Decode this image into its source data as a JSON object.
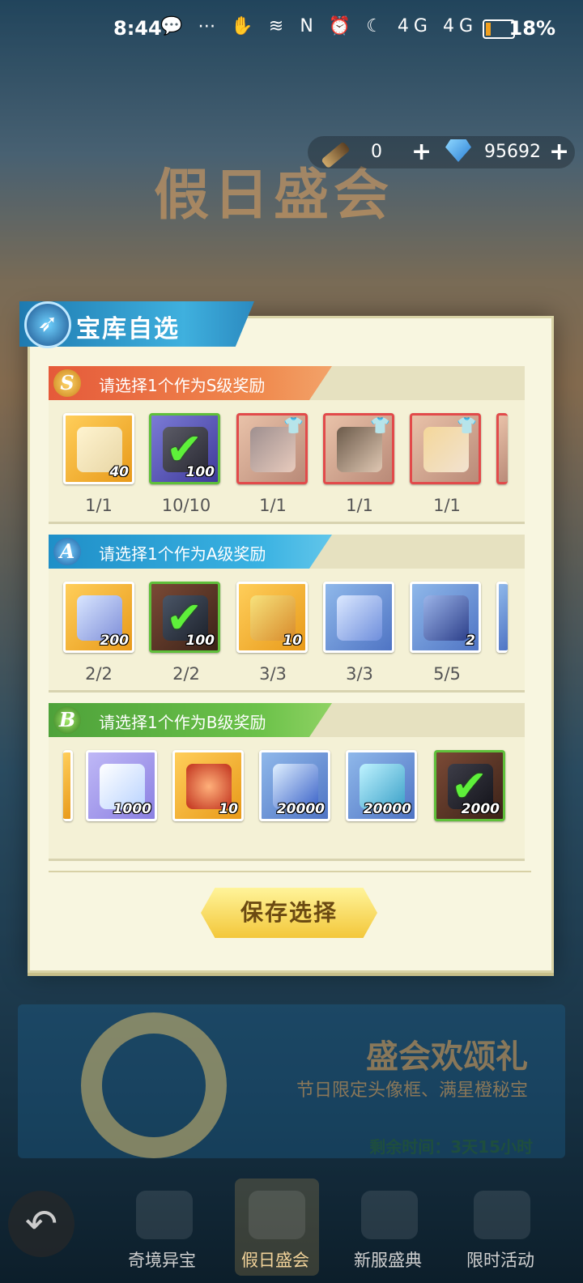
{
  "status_bar": {
    "time": "8:44",
    "left_icons": "💬 ⋯ ✋ ≋",
    "right_icons": "N ⏰ ☾ 4G 4G",
    "battery_percent": "18%"
  },
  "currency": {
    "item_count": "0",
    "gems": "95692"
  },
  "banner_title": "假日盛会",
  "modal": {
    "title": "宝库自选",
    "save_button": "保存选择",
    "sections": [
      {
        "grade": "S",
        "title": "请选择1个作为S级奖励",
        "items": [
          {
            "icon": "golden-scroll-icon",
            "qty": "40",
            "count": "1/1",
            "selected": false
          },
          {
            "icon": "mystery-cube-icon",
            "qty": "100",
            "count": "10/10",
            "selected": true
          },
          {
            "icon": "hero-portrait-icon",
            "qty": "",
            "count": "1/1",
            "selected": false
          },
          {
            "icon": "hero-portrait-icon",
            "qty": "",
            "count": "1/1",
            "selected": false
          },
          {
            "icon": "hero-portrait-icon",
            "qty": "",
            "count": "1/1",
            "selected": false
          }
        ]
      },
      {
        "grade": "A",
        "title": "请选择1个作为A级奖励",
        "items": [
          {
            "icon": "crystal-shard-icon",
            "qty": "200",
            "count": "2/2",
            "selected": false
          },
          {
            "icon": "dark-star-icon",
            "qty": "100",
            "count": "2/2",
            "selected": true
          },
          {
            "icon": "treasure-chest-icon",
            "qty": "10",
            "count": "3/3",
            "selected": false
          },
          {
            "icon": "magic-fruit-icon",
            "qty": "",
            "count": "3/3",
            "selected": false
          },
          {
            "icon": "rune-stone-icon",
            "qty": "2",
            "count": "5/5",
            "selected": false
          }
        ]
      },
      {
        "grade": "B",
        "title": "请选择1个作为B级奖励",
        "items": [
          {
            "icon": "crystal-ore-icon",
            "qty": "1000",
            "selected": false
          },
          {
            "icon": "red-gem-icon",
            "qty": "10",
            "selected": false
          },
          {
            "icon": "blue-crystal-icon",
            "qty": "20000",
            "selected": false
          },
          {
            "icon": "crystal-plant-icon",
            "qty": "20000",
            "selected": false
          },
          {
            "icon": "dark-ore-icon",
            "qty": "2000",
            "selected": true
          }
        ]
      }
    ]
  },
  "welcome": {
    "title": "盛会欢颂礼",
    "subtitle": "节日限定头像框、满星橙秘宝",
    "time_left": "剩余时间：3天15小时"
  },
  "bottom_nav": [
    {
      "label": "奇境异宝"
    },
    {
      "label": "假日盛会"
    },
    {
      "label": "新服盛典"
    },
    {
      "label": "限时活动"
    }
  ]
}
